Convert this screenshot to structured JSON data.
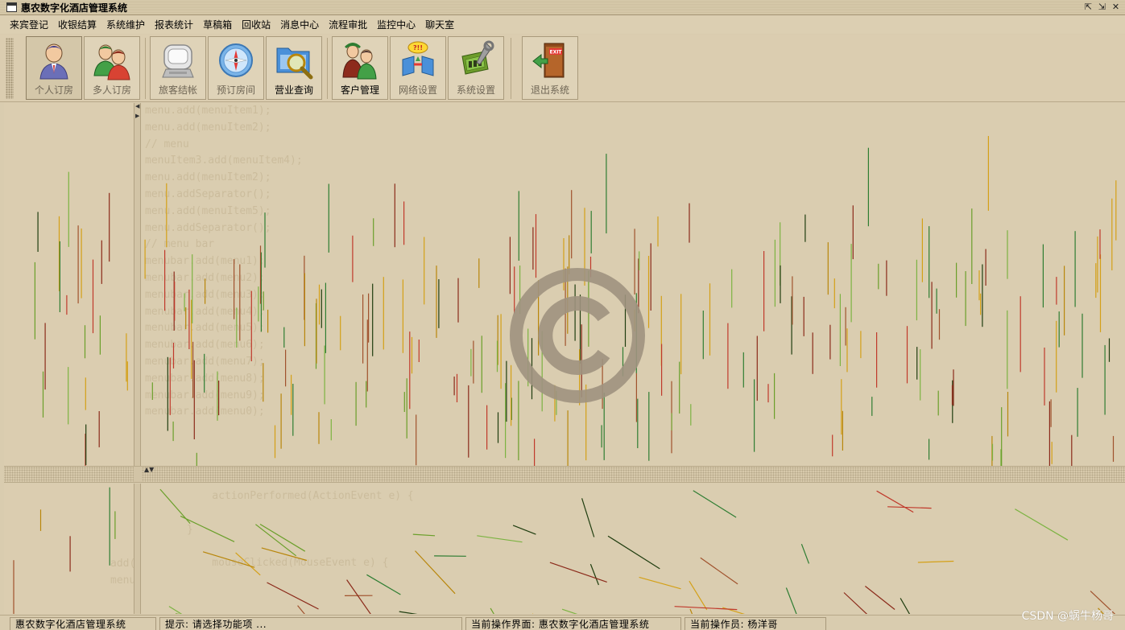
{
  "window": {
    "title": "惠农数字化酒店管理系统",
    "buttons": [
      "⇱",
      "⇲",
      "✕"
    ]
  },
  "menubar": {
    "items": [
      "来宾登记",
      "收银结算",
      "系统维护",
      "报表统计",
      "草稿箱",
      "回收站",
      "消息中心",
      "流程审批",
      "监控中心",
      "聊天室"
    ]
  },
  "toolbar": {
    "buttons": [
      {
        "label": "个人订房",
        "icon": "single-person-icon"
      },
      {
        "label": "多人订房",
        "icon": "two-persons-icon"
      },
      {
        "label": "旅客结帐",
        "icon": "computer-icon"
      },
      {
        "label": "预订房间",
        "icon": "compass-icon"
      },
      {
        "label": "营业查询",
        "icon": "magnifier-folder-icon"
      },
      {
        "label": "客户管理",
        "icon": "customer-icon"
      },
      {
        "label": "网络设置",
        "icon": "network-icon"
      },
      {
        "label": "系统设置",
        "icon": "tools-icon"
      },
      {
        "label": "退出系统",
        "icon": "exit-door-icon"
      }
    ],
    "exit_sign_text": "EXIT",
    "network_badge_text": "?!!"
  },
  "colors": {
    "rain": [
      "#8b2a1a",
      "#c0392b",
      "#2e7d32",
      "#6a9f2a",
      "#b8860b",
      "#d4a017",
      "#1f3d0f",
      "#a0522d",
      "#7cb342"
    ]
  },
  "statusbar": {
    "app_name": "惠农数字化酒店管理系统",
    "hint": "提示: 请选择功能项 ...",
    "current_view": "当前操作界面: 惠农数字化酒店管理系统",
    "operator": "当前操作员: 杨洋哥"
  },
  "watermark": "CSDN @蜗牛杨哥"
}
